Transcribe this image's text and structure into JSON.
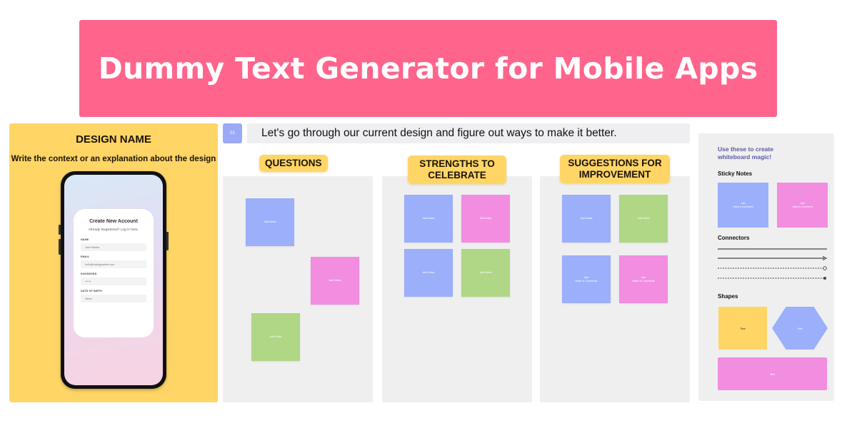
{
  "banner": {
    "title": "Dummy Text Generator for Mobile Apps"
  },
  "design_panel": {
    "name": "DESIGN NAME",
    "description": "Write the context or an explanation about the design",
    "form": {
      "title": "Create New Account",
      "subtitle": "Already Registered? Log in here.",
      "fields": [
        {
          "label": "NAME",
          "value": "Jane Martha"
        },
        {
          "label": "EMAIL",
          "value": "hello@reallygreatsite.com"
        },
        {
          "label": "PASSWORD",
          "value": "******"
        },
        {
          "label": "DATE OF BIRTH",
          "value": "Select"
        }
      ]
    }
  },
  "step": {
    "number": "01",
    "text": "Let's go through our current design and figure out ways to make it better."
  },
  "columns": [
    {
      "title": "QUESTIONS",
      "notes": [
        {
          "color": "blue",
          "title": "",
          "text": "Add Notes"
        },
        {
          "color": "pink",
          "title": "",
          "text": "Add Notes"
        },
        {
          "color": "green",
          "title": "",
          "text": "Add Notes"
        }
      ]
    },
    {
      "title": "STRENGTHS TO CELEBRATE",
      "notes": [
        {
          "color": "blue",
          "title": "",
          "text": "Add Notes"
        },
        {
          "color": "pink",
          "title": "",
          "text": "Add Notes"
        },
        {
          "color": "blue",
          "title": "",
          "text": "Add Notes"
        },
        {
          "color": "green",
          "title": "",
          "text": "Add Notes"
        }
      ]
    },
    {
      "title": "SUGGESTIONS FOR IMPROVEMENT",
      "notes": [
        {
          "color": "blue",
          "title": "",
          "text": "Add Notes"
        },
        {
          "color": "green",
          "title": "",
          "text": "Add Notes"
        },
        {
          "color": "blue",
          "title": "Add",
          "text": "Notes & Comments"
        },
        {
          "color": "pink",
          "title": "Add",
          "text": "Notes & Comments"
        }
      ]
    }
  ],
  "kit": {
    "title": "Use these to create whiteboard magic!",
    "sticky_heading": "Sticky Notes",
    "stickies": [
      {
        "color": "blue",
        "title": "Add",
        "text": "Notes & Comments"
      },
      {
        "color": "pink",
        "title": "Add",
        "text": "Notes & Comments"
      }
    ],
    "connectors_heading": "Connectors",
    "connectors": [
      "plain-line",
      "arrow-line",
      "dashed-circle-end",
      "dashed-dot-end"
    ],
    "shapes_heading": "Shapes",
    "shapes": [
      {
        "type": "square",
        "color": "yellow",
        "text": "Text"
      },
      {
        "type": "hexagon",
        "color": "blue",
        "text": "Text"
      },
      {
        "type": "rectangle",
        "color": "pink",
        "text": "Text"
      }
    ]
  },
  "colors": {
    "banner": "#ff648c",
    "yellow": "#ffd566",
    "blue": "#9baffb",
    "pink": "#f28de0",
    "green": "#afd786",
    "panel_gray": "#efefef"
  }
}
